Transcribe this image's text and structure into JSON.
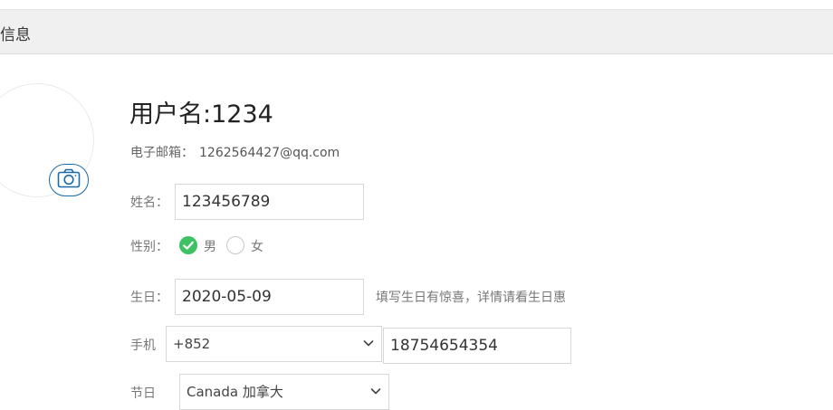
{
  "header": {
    "title": "信息"
  },
  "profile": {
    "username_line": "用户名:1234",
    "email_label": "电子邮箱：",
    "email_value": "1262564427@qq.com"
  },
  "form": {
    "name_label": "姓名：",
    "name_value": "123456789",
    "gender_label": "性别：",
    "gender_male": "男",
    "gender_female": "女",
    "gender_selected": "男",
    "birthday_label": "生日：",
    "birthday_value": "2020-05-09",
    "birthday_hint": "填写生日有惊喜，详情请看生日惠",
    "phone_label": "手机",
    "phone_country_code": "+852",
    "phone_number": "18754654354",
    "region_label": "节日",
    "region_value": "Canada 加拿大"
  },
  "icons": {
    "camera": "camera-icon",
    "check": "check-icon",
    "chevron": "chevron-down-icon"
  },
  "colors": {
    "accent_green": "#3ec065",
    "camera_blue": "#1a6aa8",
    "header_bg": "#f0f0f0"
  }
}
